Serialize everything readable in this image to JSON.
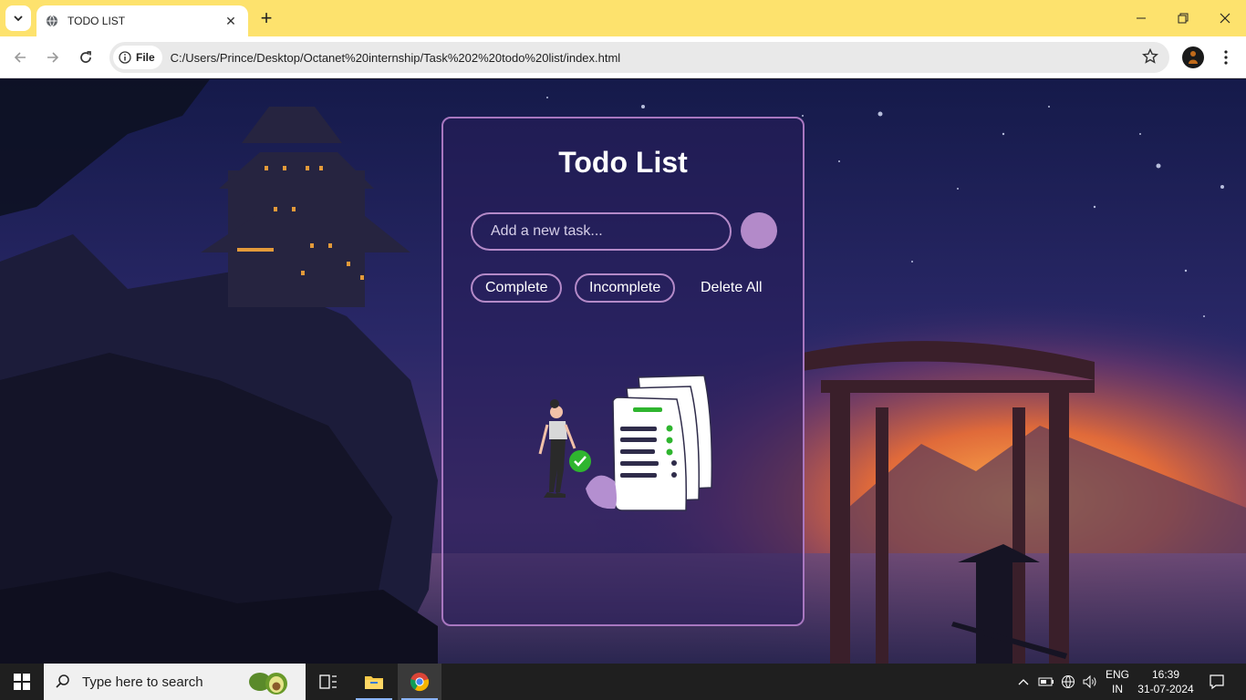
{
  "browser": {
    "tab_title": "TODO LIST",
    "new_tab_label": "+",
    "close_tab_label": "✕",
    "file_chip_label": "File",
    "url": "C:/Users/Prince/Desktop/Octanet%20internship/Task%202%20todo%20list/index.html"
  },
  "page": {
    "title": "Todo List",
    "input_placeholder": "Add a new task...",
    "filters": {
      "complete": "Complete",
      "incomplete": "Incomplete",
      "delete_all": "Delete All"
    }
  },
  "taskbar": {
    "search_placeholder": "Type here to search",
    "language_line1": "ENG",
    "language_line2": "IN",
    "time": "16:39",
    "date": "31-07-2024"
  },
  "colors": {
    "titlebar": "#fde26d",
    "card_border": "#a877c0",
    "add_button": "#b38ac9"
  }
}
